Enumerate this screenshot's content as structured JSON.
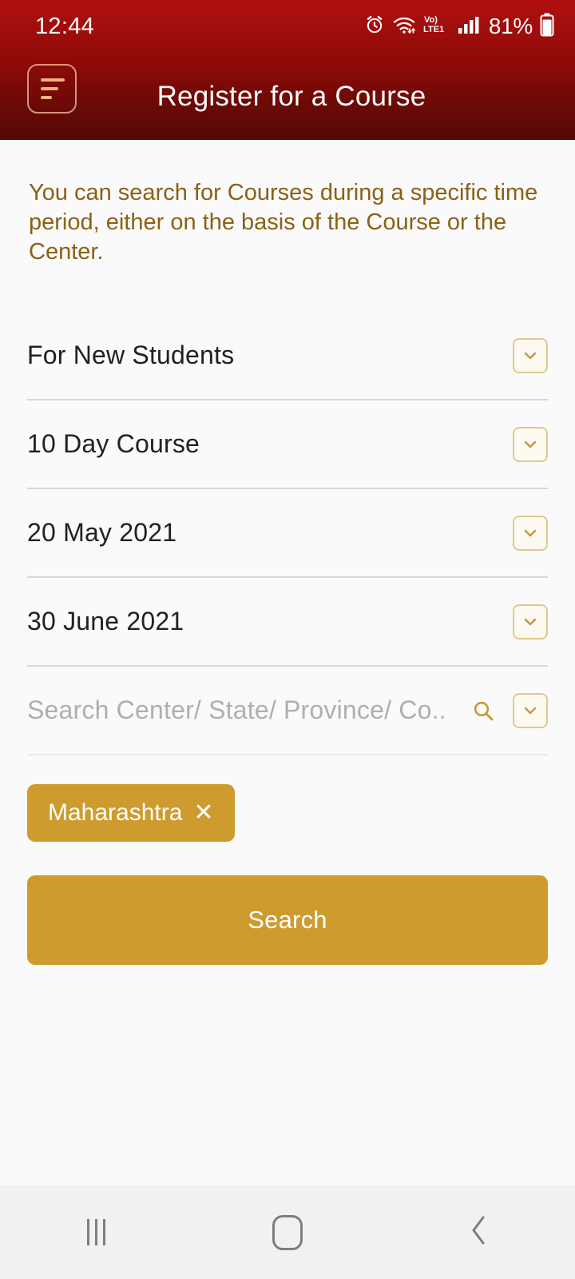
{
  "status_bar": {
    "time": "12:44",
    "battery_percent": "81%",
    "network_label": "LTE1",
    "volte_label": "Vo)",
    "icons": [
      "alarm-icon",
      "wifi-icon",
      "volte-icon",
      "signal-icon",
      "battery-icon"
    ]
  },
  "app_bar": {
    "menu_icon": "hamburger-menu-icon",
    "title": "Register for a Course"
  },
  "main": {
    "intro_text": "You can search for Courses during a specific time period, either on the basis of the Course or the Center.",
    "fields": [
      {
        "label": "For New Students",
        "type": "select",
        "name": "student-type"
      },
      {
        "label": "10 Day Course",
        "type": "select",
        "name": "course-type"
      },
      {
        "label": "20 May 2021",
        "type": "date",
        "name": "start-date"
      },
      {
        "label": "30 June 2021",
        "type": "date",
        "name": "end-date"
      }
    ],
    "search_field": {
      "placeholder": "Search Center/ State/ Province/ Co..",
      "value": "",
      "search_icon": "magnifier-icon"
    },
    "chips": [
      {
        "label": "Maharashtra",
        "remove_glyph": "✕"
      }
    ],
    "submit_label": "Search"
  },
  "nav_bar": {
    "recents_label": "recents-icon",
    "home_label": "home-icon",
    "back_label": "back-icon"
  },
  "colors": {
    "header_top": "#B01010",
    "header_bottom": "#520805",
    "accent_gold": "#CE9B2E",
    "intro_text": "#8A6116",
    "body_bg": "#FAFAFA"
  }
}
